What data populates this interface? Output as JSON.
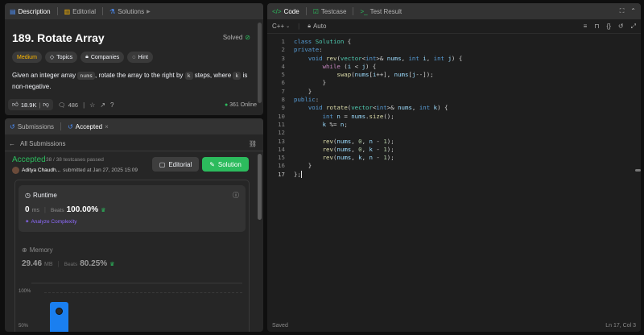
{
  "left_top": {
    "tabs": [
      {
        "label": "Description",
        "icon": "document-icon"
      },
      {
        "label": "Editorial",
        "icon": "book-icon"
      },
      {
        "label": "Solutions",
        "icon": "flask-icon"
      }
    ],
    "title": "189. Rotate Array",
    "status": "Solved",
    "tags": [
      "Medium",
      "Topics",
      "Companies",
      "Hint"
    ],
    "description": {
      "part1": "Given an integer array ",
      "code1": "nums",
      "part2": ", rotate the array to the right by ",
      "code2": "k",
      "part3": " steps, where ",
      "code3": "k",
      "part4": " is",
      "line2": "non-negative."
    },
    "footer": {
      "likes": "18.9K",
      "comments": "486",
      "online": "361 Online"
    }
  },
  "left_bottom": {
    "tabs": [
      {
        "label": "Submissions"
      },
      {
        "label": "Accepted"
      }
    ],
    "back_label": "All Submissions",
    "result": "Accepted",
    "testcases": "38 / 38 testcases passed",
    "author": "Aditya Chaudh...",
    "submitted": "submitted at Jan 27, 2025 15:09",
    "editorial_btn": "Editorial",
    "solution_btn": "Solution",
    "runtime": {
      "label": "Runtime",
      "value": "0",
      "unit": "ms",
      "beats_label": "Beats",
      "beats": "100.00%",
      "analyze": "Analyze Complexity"
    },
    "memory": {
      "label": "Memory",
      "value": "29.46",
      "unit": "MB",
      "beats_label": "Beats",
      "beats": "80.25%"
    },
    "chart_labels": [
      "100%",
      "50%"
    ]
  },
  "editor": {
    "tabs": [
      {
        "label": "Code"
      },
      {
        "label": "Testcase"
      },
      {
        "label": "Test Result"
      }
    ],
    "language": "C++",
    "mode": "Auto",
    "line_numbers": [
      "1",
      "2",
      "3",
      "4",
      "5",
      "6",
      "7",
      "8",
      "9",
      "10",
      "11",
      "12",
      "13",
      "14",
      "15",
      "16",
      "17"
    ],
    "status_left": "Saved",
    "status_right": "Ln 17, Col 3"
  },
  "colors": {
    "accent_green": "#2cbb5d",
    "accent_blue": "#4c8df6",
    "medium_yellow": "#ffb800"
  }
}
